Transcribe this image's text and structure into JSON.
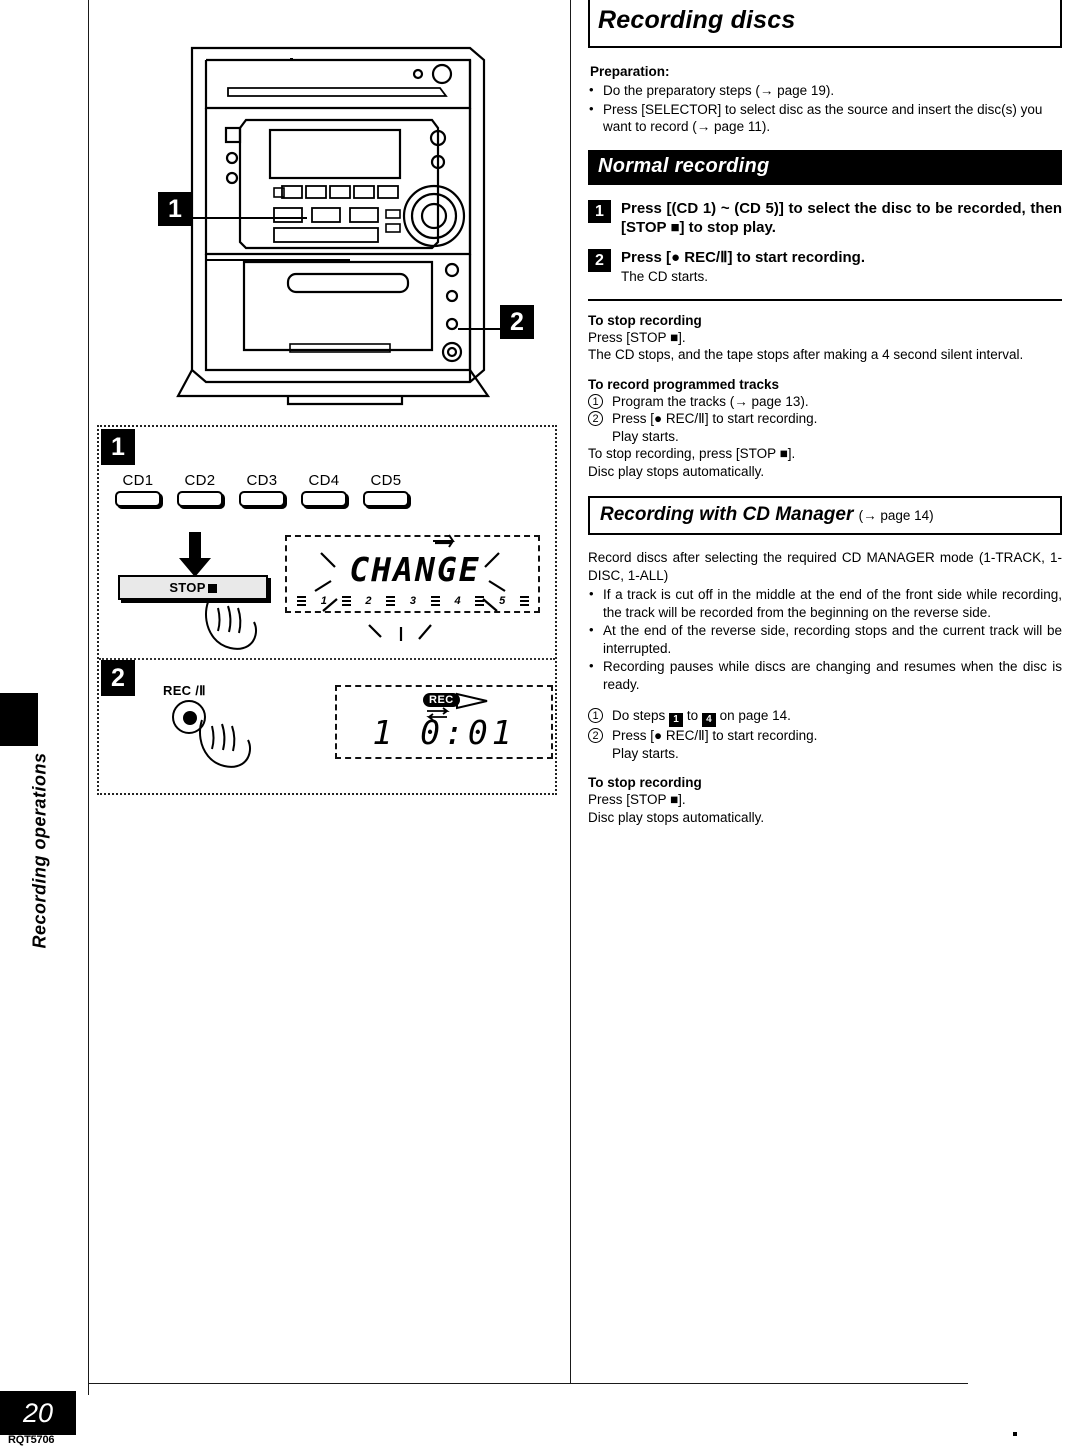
{
  "page": {
    "number": "20",
    "doc_code": "RQT5706",
    "side_tab_label": "Recording operations"
  },
  "title": "Recording discs",
  "preparation": {
    "heading": "Preparation:",
    "items": [
      "Do the preparatory steps (→ page 19).",
      "Press [SELECTOR] to select disc as the source and insert the disc(s) you want to record (→ page 11)."
    ]
  },
  "normal_recording": {
    "heading": "Normal recording",
    "steps": [
      {
        "num": "1",
        "lead": "Press [(CD 1) ~ (CD 5)] to select the disc to be recorded, then [STOP ■] to stop play.",
        "sub": ""
      },
      {
        "num": "2",
        "lead": "Press [● REC/Ⅱ] to start recording.",
        "sub": "The CD starts."
      }
    ],
    "stop": {
      "heading": "To stop recording",
      "line1": "Press [STOP ■].",
      "line2": "The CD stops, and the tape stops after making a 4 second silent interval."
    },
    "programmed": {
      "heading": "To record programmed tracks",
      "items": [
        "Program the tracks (→ page 13).",
        "Press [● REC/Ⅱ] to start recording."
      ],
      "item2_sub": "Play starts.",
      "line1": "To stop recording, press [STOP ■].",
      "line2": "Disc play stops automatically."
    }
  },
  "cd_manager": {
    "heading": "Recording with CD Manager",
    "heading_ref": "(→ page 14)",
    "intro": "Record discs after selecting the required CD MANAGER mode (1-TRACK, 1-DISC, 1-ALL)",
    "bullets": [
      "If a track is cut off in the middle at the end of the front side while recording, the track will be recorded from the beginning on the reverse side.",
      "At the end of the reverse side, recording stops and the current track will be interrupted.",
      "Recording pauses while discs are changing and resumes when the disc is ready."
    ],
    "steps": [
      "Do steps",
      "Press [● REC/Ⅱ] to start recording."
    ],
    "step1_from": "1",
    "step1_mid": "to",
    "step1_to": "4",
    "step1_tail": "on page 14.",
    "step2_sub": "Play starts.",
    "stop": {
      "heading": "To stop recording",
      "line1": "Press [STOP ■].",
      "line2": "Disc play stops automatically."
    }
  },
  "illustration": {
    "callout_1": "1",
    "callout_2": "2",
    "panel_step_1": "1",
    "panel_step_2": "2",
    "cd_buttons": [
      "CD1",
      "CD2",
      "CD3",
      "CD4",
      "CD5"
    ],
    "stop_button_label": "STOP",
    "rec_button_label": "REC /Ⅱ",
    "lcd_change_text": "CHANGE",
    "lcd_disc_numbers": [
      "1",
      "2",
      "3",
      "4",
      "5"
    ],
    "lcd_rec_badge": "REC",
    "lcd_time_text": "1    0:01"
  },
  "colors": {
    "ink": "#000000",
    "paper": "#ffffff"
  }
}
